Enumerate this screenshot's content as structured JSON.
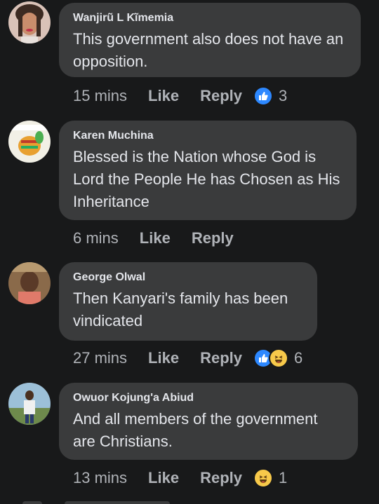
{
  "comments": [
    {
      "name": "Wanjirũ L Kĩmemia",
      "text": "This government also does not have an opposition.",
      "time": "15 mins",
      "like_label": "Like",
      "reply_label": "Reply",
      "reactions": [
        "like-icon"
      ],
      "reaction_count": "3"
    },
    {
      "name": "Karen Muchina",
      "text": "Blessed is the  Nation whose God is Lord the People He has Chosen as His Inheritance",
      "time": "6 mins",
      "like_label": "Like",
      "reply_label": "Reply"
    },
    {
      "name": "George Olwal",
      "text": "Then Kanyari's family has been vindicated",
      "time": "27 mins",
      "like_label": "Like",
      "reply_label": "Reply",
      "reactions": [
        "like-icon",
        "haha-icon"
      ],
      "reaction_count": "6"
    },
    {
      "name": "Owuor Kojung'a Abiud",
      "text": "And all members of the government are Christians.",
      "time": "13 mins",
      "like_label": "Like",
      "reply_label": "Reply",
      "reactions": [
        "haha-icon"
      ],
      "reaction_count": "1"
    }
  ],
  "colors": {
    "background": "#18191a",
    "bubble": "#3a3b3c",
    "primary_text": "#e4e6eb",
    "secondary_text": "#b0b3b8",
    "like_blue": "#2d88ff",
    "haha_yellow": "#f7c94a"
  }
}
